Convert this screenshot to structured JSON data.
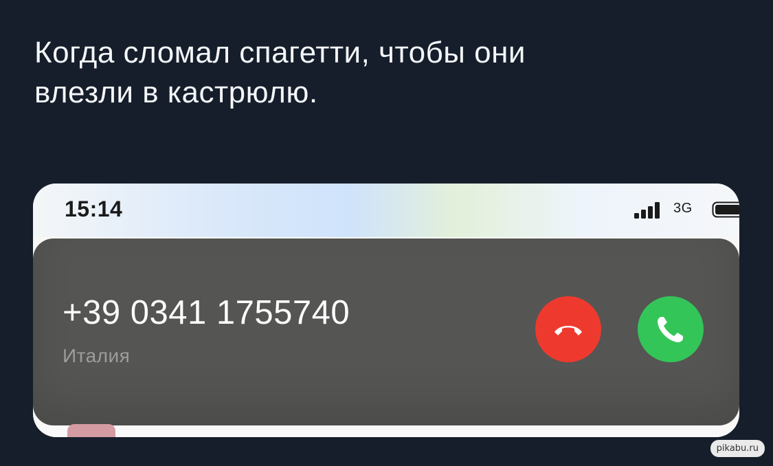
{
  "post": {
    "caption": "Когда сломал спагетти, чтобы они\nвлезли в кастрюлю."
  },
  "status_bar": {
    "time": "15:14",
    "network": "3G",
    "signal_icon": "signal-bars-icon",
    "battery_icon": "battery-icon"
  },
  "incoming_call": {
    "number": "+39 0341 1755740",
    "location": "Италия",
    "decline_icon": "phone-hangup-icon",
    "accept_icon": "phone-icon",
    "colors": {
      "banner": "#555554",
      "decline": "#ee3a2e",
      "accept": "#34c558"
    }
  },
  "watermark": {
    "text": "pikabu.ru"
  }
}
